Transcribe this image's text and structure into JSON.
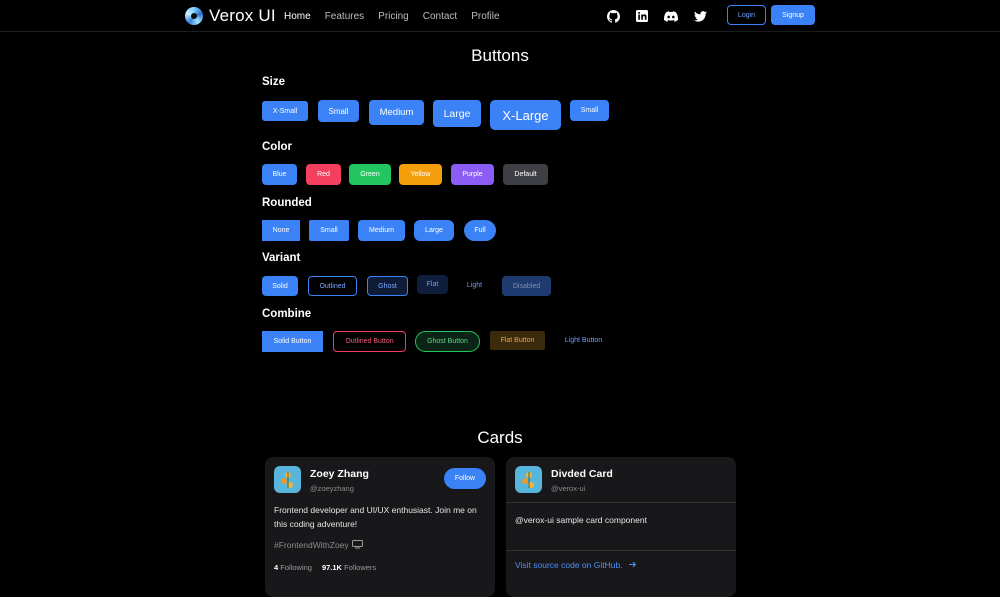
{
  "nav": {
    "brand": "Verox UI",
    "links": [
      "Home",
      "Features",
      "Pricing",
      "Contact",
      "Profile"
    ],
    "social_icons": [
      "github-icon",
      "linkedin-icon",
      "discord-icon",
      "twitter-icon"
    ],
    "login": "Login",
    "signup": "Signup"
  },
  "buttons_section": {
    "title": "Buttons",
    "size": {
      "title": "Size",
      "items": [
        "X-Small",
        "Small",
        "Medium",
        "Large",
        "X-Large",
        "Small"
      ]
    },
    "color": {
      "title": "Color",
      "items": [
        "Blue",
        "Red",
        "Green",
        "Yellow",
        "Purple",
        "Default"
      ]
    },
    "rounded": {
      "title": "Rounded",
      "items": [
        "None",
        "Small",
        "Medium",
        "Large",
        "Full"
      ]
    },
    "variant": {
      "title": "Variant",
      "items": [
        "Solid",
        "Outlined",
        "Ghost",
        "Flat",
        "Light",
        "Disabled"
      ]
    },
    "combine": {
      "title": "Combine",
      "items": [
        "Solid Button",
        "Outlined Button",
        "Ghost Button",
        "Flat Button",
        "Light Button"
      ]
    }
  },
  "colors": {
    "accent": "#3b82f6",
    "red": "#f43f5e",
    "green": "#22c55e",
    "yellow": "#f59e0b",
    "purple": "#8b5cf6",
    "default": "#3f3f46"
  },
  "cards_section": {
    "title": "Cards",
    "profile": {
      "name": "Zoey Zhang",
      "handle": "@zoeyzhang",
      "follow": "Follow",
      "bio": "Frontend developer and UI/UX enthusiast. Join me on this coding adventure!",
      "tag": "#FrontendWithZoey",
      "following_count": "4",
      "following_label": "Following",
      "followers_count": "97.1K",
      "followers_label": "Followers"
    },
    "divided": {
      "name": "Divded Card",
      "handle": "@verox-ui",
      "body": "@verox-ui sample card component",
      "link": "Visit source code on GitHub."
    }
  }
}
